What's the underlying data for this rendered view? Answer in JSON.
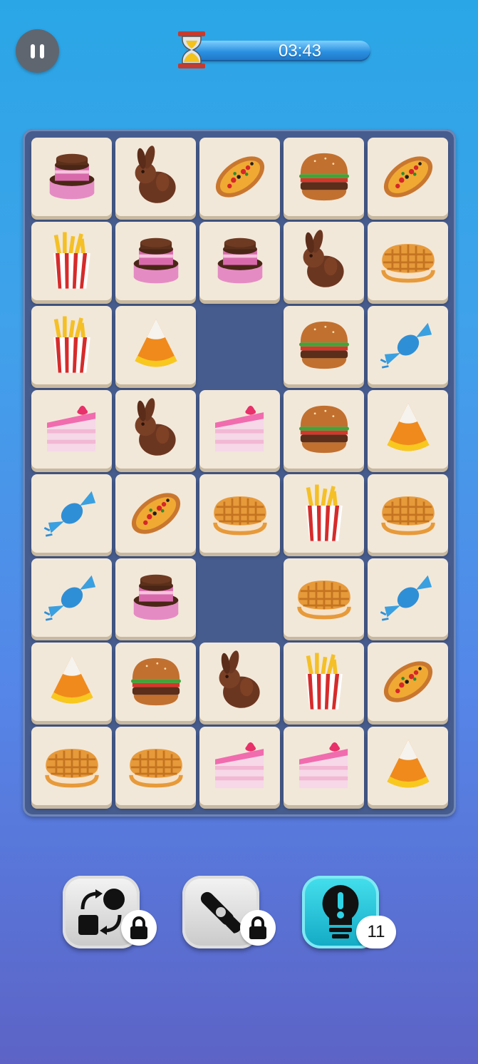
{
  "header": {
    "timer": "03:43"
  },
  "board": {
    "rows": [
      [
        "cake-icon",
        "bunny-icon",
        "pizza-icon",
        "burger-icon",
        "pizza-icon"
      ],
      [
        "fries-icon",
        "cake-icon",
        "cake-icon",
        "bunny-icon",
        "waffle-icon"
      ],
      [
        "fries-icon",
        "candy-corn-icon",
        null,
        "burger-icon",
        "wrapped-candy-icon"
      ],
      [
        "cake-slice-icon",
        "bunny-icon",
        "cake-slice-icon",
        "burger-icon",
        "candy-corn-icon"
      ],
      [
        "wrapped-candy-icon",
        "pizza-icon",
        "waffle-icon",
        "fries-icon",
        "waffle-icon"
      ],
      [
        "wrapped-candy-icon",
        "cake-icon",
        null,
        "waffle-icon",
        "wrapped-candy-icon"
      ],
      [
        "candy-corn-icon",
        "burger-icon",
        "bunny-icon",
        "fries-icon",
        "pizza-icon"
      ],
      [
        "waffle-icon",
        "waffle-icon",
        "cake-slice-icon",
        "cake-slice-icon",
        "candy-corn-icon"
      ]
    ]
  },
  "toolbar": {
    "shuffle": {
      "icon": "shuffle-icon",
      "locked": true
    },
    "remove": {
      "icon": "scissors-icon",
      "locked": true
    },
    "hint": {
      "icon": "lightbulb-icon",
      "count": "11"
    }
  }
}
